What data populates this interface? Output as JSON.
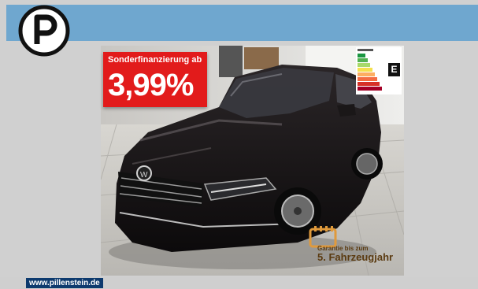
{
  "promo": {
    "line1": "Sonderfinanzierung ab",
    "rate": "3,99%"
  },
  "energy_label": {
    "class": "E"
  },
  "warranty": {
    "line1": "Garantie bis zum",
    "line2": "5. Fahrzeugjahr"
  },
  "footer": {
    "website": "www.pillenstein.de"
  },
  "colors": {
    "brand_blue": "#6fa7cf",
    "promo_red": "#e21b1b",
    "footer_navy": "#0d3a6e",
    "warranty_orange": "#e09a3c"
  },
  "icons": {
    "logo": "pillenstein-p-logo-icon",
    "warranty": "calendar-warranty-icon"
  }
}
